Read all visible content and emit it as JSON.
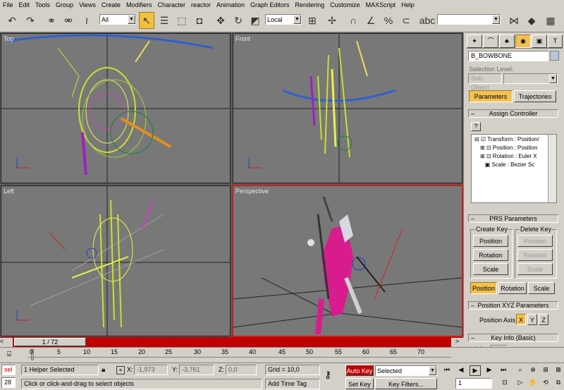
{
  "menu": [
    "File",
    "Edit",
    "Tools",
    "Group",
    "Views",
    "Create",
    "Modifiers",
    "Character",
    "reactor",
    "Animation",
    "Graph Editors",
    "Rendering",
    "Customize",
    "MAXScript",
    "Help"
  ],
  "toolbar": {
    "selection_filter": "All",
    "coord_system": "Local",
    "named_selection": ""
  },
  "viewports": {
    "top": "Top",
    "front": "Front",
    "left": "Left",
    "perspective": "Perspective"
  },
  "panel": {
    "object_name": "B_BOWBONE",
    "selection_level_label": "Selection Level:",
    "sub_object": "Sub-Object",
    "tab_parameters": "Parameters",
    "tab_trajectories": "Trajectories",
    "assign_controller": "Assign Controller",
    "tree": [
      "Transform : Position/",
      "Position : Position",
      "Rotation : Euler X",
      "Scale : Bezier Sc"
    ],
    "prs_parameters": "PRS Parameters",
    "create_key": "Create Key",
    "delete_key": "Delete Key",
    "create_buttons": [
      "Position",
      "Rotation",
      "Scale"
    ],
    "delete_buttons": [
      "Position",
      "Rotation",
      "Scale"
    ],
    "mode_buttons": [
      "Position",
      "Rotation",
      "Scale"
    ],
    "position_xyz": "Position XYZ Parameters",
    "position_axis_label": "Position Axis:",
    "axes": [
      "X",
      "Y",
      "Z"
    ],
    "key_info": "Key Info (Basic)"
  },
  "timeline": {
    "frame_display": "1 / 72",
    "ticks": [
      "0",
      "5",
      "10",
      "15",
      "20",
      "25",
      "30",
      "35",
      "40",
      "45",
      "50",
      "55",
      "60",
      "65",
      "70"
    ]
  },
  "status": {
    "sel_tag": "sel",
    "frame_num": "28",
    "selected_text": "1 Helper Selected",
    "prompt": "Click or click-and-drag to select objects",
    "x_label": "X:",
    "x_value": "-1,973",
    "y_label": "Y:",
    "y_value": "-3,761",
    "z_label": "Z:",
    "z_value": "0,0",
    "grid": "Grid = 10,0",
    "add_time_tag": "Add Time Tag",
    "auto_key": "Auto Key",
    "selected_combo": "Selected",
    "set_key": "Set Key",
    "key_filters": "Key Filters...",
    "current_frame": "1"
  },
  "colors": {
    "active_button": "#f3c150",
    "auto_key": "#c00000",
    "viewport_bg": "#787878"
  }
}
